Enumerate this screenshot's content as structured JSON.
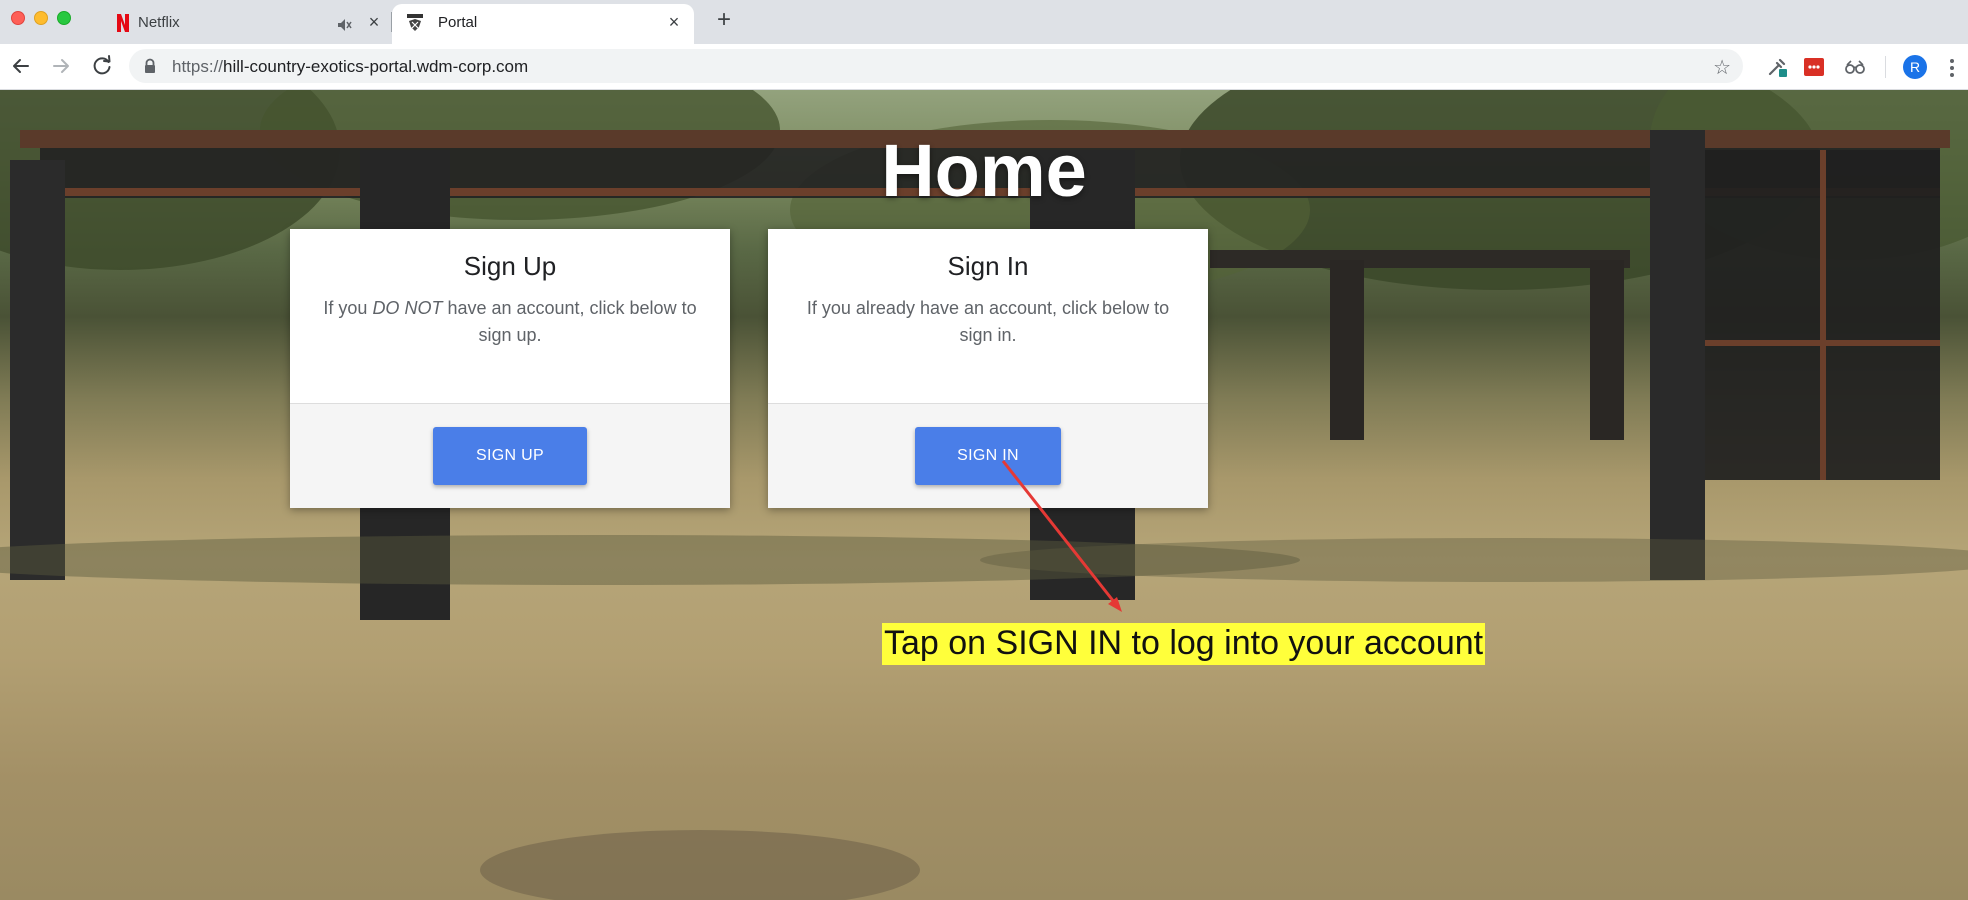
{
  "browser": {
    "tabs": [
      {
        "title": "Netflix",
        "favicon": "netflix-logo-icon",
        "audio_icon": "speaker-muted-icon",
        "active": false
      },
      {
        "title": "Portal",
        "favicon": "portal-logo-icon",
        "active": true
      }
    ],
    "url": {
      "scheme": "https://",
      "host": "hill-country-exotics-portal.wdm-corp.com"
    },
    "avatar_letter": "R",
    "icons": [
      "back-arrow-icon",
      "forward-arrow-icon",
      "reload-icon",
      "lock-icon",
      "star-icon",
      "eyedropper-extension-icon",
      "red-extension-icon",
      "glasses-extension-icon",
      "kebab-menu-icon"
    ]
  },
  "page": {
    "heading": "Home",
    "signup": {
      "title": "Sign Up",
      "text_before": "If you ",
      "text_emphasis": "DO NOT",
      "text_after": " have an account, click below to sign up.",
      "button": "SIGN UP"
    },
    "signin": {
      "title": "Sign In",
      "text": "If you already have an account, click below to sign in.",
      "button": "SIGN IN"
    },
    "annotation": "Tap on SIGN IN to log into your account"
  },
  "colors": {
    "button_blue": "#4a7ee8",
    "annotation_highlight": "#ffff3b",
    "annotation_arrow": "#e53935",
    "tabstrip_bg": "#dee1e6"
  }
}
